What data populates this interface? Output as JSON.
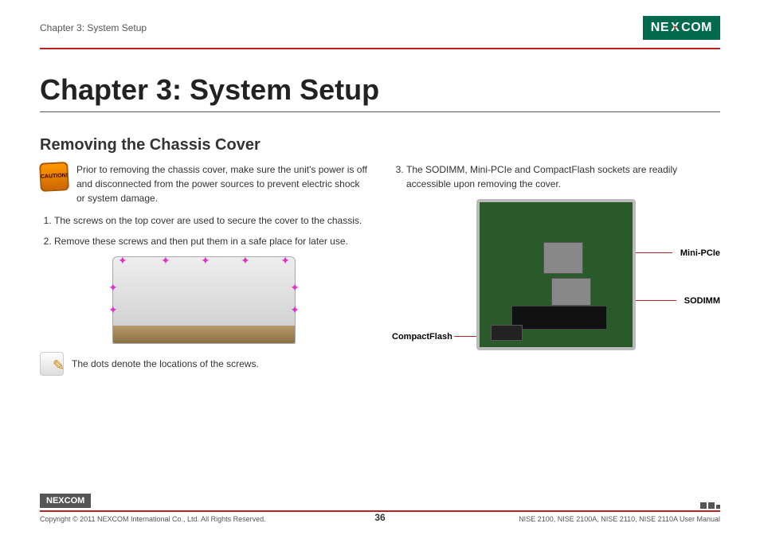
{
  "header": {
    "breadcrumb": "Chapter 3: System Setup",
    "logo_text": "NEXCOM"
  },
  "chapter_title": "Chapter 3: System Setup",
  "section_title": "Removing the Chassis Cover",
  "left_column": {
    "caution": "Prior to removing the chassis cover, make sure the unit's power is off and disconnected from the power sources to prevent electric shock or system damage.",
    "caution_badge": "CAUTION!",
    "step1": "The screws on the top cover are used to secure the cover to the chassis.",
    "step2": "Remove these screws and then put them in a safe place for later use.",
    "note": "The dots denote the locations of the screws."
  },
  "right_column": {
    "step3": "The SODIMM, Mini-PCIe and CompactFlash sockets are readily accessible upon removing the cover.",
    "labels": {
      "mini_pcie": "Mini-PCIe",
      "sodimm": "SODIMM",
      "compactflash": "CompactFlash"
    }
  },
  "footer": {
    "logo_text": "NEXCOM",
    "copyright": "Copyright © 2011 NEXCOM International Co., Ltd. All Rights Reserved.",
    "page": "36",
    "manual": "NISE 2100, NISE 2100A, NISE 2110, NISE 2110A User Manual"
  }
}
